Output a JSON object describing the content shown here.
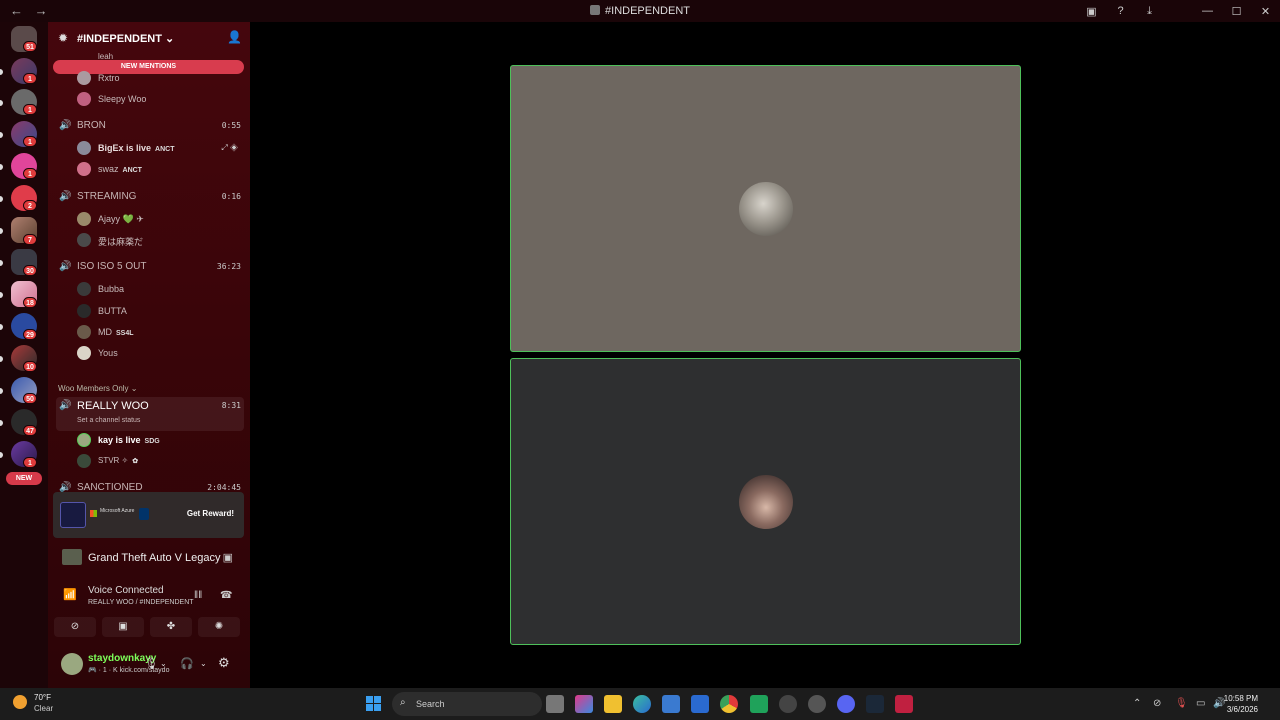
{
  "window": {
    "title": "#INDEPENDENT",
    "back_icon": "←",
    "forward_icon": "→",
    "controls": [
      "▣",
      "?",
      "⤓",
      "—",
      "☐",
      "✕"
    ]
  },
  "guilds": {
    "badges": [
      "51",
      "1",
      "1",
      "1",
      "1",
      "2",
      "7",
      "30",
      "18",
      "29",
      "10",
      "50",
      "47",
      "1"
    ],
    "new_label": "NEW"
  },
  "server": {
    "name": "#INDEPENDENT ⌄",
    "new_mentions": "NEW MENTIONS"
  },
  "channels": [
    {
      "name": "BRON",
      "time": "0:55"
    },
    {
      "name": "STREAMING",
      "time": "0:16"
    },
    {
      "name": "ISO ISO 5 OUT",
      "time": "36:23"
    },
    {
      "name": "REALLY WOO",
      "time": "8:31",
      "status": "Set a channel status"
    },
    {
      "name": "SANCTIONED",
      "time": "2:04:45"
    }
  ],
  "members": {
    "top": [
      "leah",
      "Rxtro",
      "Sleepy Woo"
    ],
    "bron": [
      {
        "name": "BigEx is live",
        "tag": "ANCT"
      },
      {
        "name": "swaz",
        "tag": "ANCT"
      }
    ],
    "streaming": [
      "Ajayy 💚 ✈",
      "愛は麻薬だ"
    ],
    "iso": [
      {
        "name": "Bubba",
        "tag": ""
      },
      {
        "name": "BUTTA",
        "tag": ""
      },
      {
        "name": "MD",
        "tag": "SS4L"
      },
      {
        "name": "Yous",
        "tag": ""
      }
    ],
    "really_woo": [
      {
        "name": "kay is live",
        "tag": "SDG"
      },
      {
        "name": "STVR ✧",
        "tag": "✿"
      }
    ]
  },
  "category": "Woo Members Only ⌄",
  "promo": {
    "brand": "Microsoft Azure",
    "cta": "Get Reward!"
  },
  "activity": {
    "game": "Grand Theft Auto V Legacy"
  },
  "voice": {
    "title": "Voice Connected",
    "subtitle": "REALLY WOO / #INDEPENDENT"
  },
  "user": {
    "name": "staydownkayy",
    "status": "🎮 · 1 · K kick.com/staydo"
  },
  "taskbar": {
    "temp": "70°F",
    "condition": "Clear",
    "search_placeholder": "Search",
    "time": "10:58 PM",
    "date": "3/6/2026"
  },
  "colors": {
    "accent_green": "#4ec05a",
    "mention_red": "#d83c4e",
    "sidebar_bg": "#3a0509"
  }
}
